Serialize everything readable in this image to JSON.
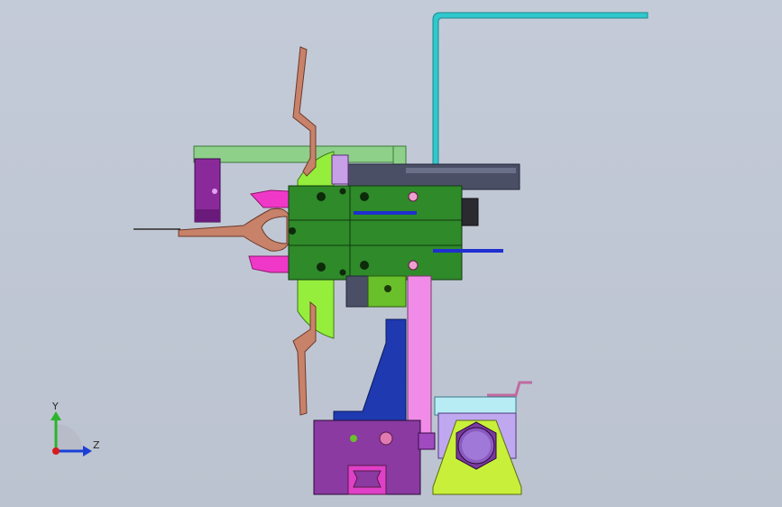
{
  "viewport": {
    "background_top": "#c4cbd8",
    "background_bottom": "#bcc3d0"
  },
  "triad": {
    "y_label": "Y",
    "z_label": "Z",
    "y_color": "#2bb52b",
    "z_color": "#1c3fd6",
    "x_color": "#d61c1c"
  },
  "colors": {
    "cyan_tube": "#30c8cc",
    "light_green_bar": "#8ed08a",
    "gripper_body": "#2f8a2a",
    "lime_plate": "#95ee3c",
    "copper_part": "#c8826a",
    "magenta_finger": "#f038c8",
    "purple_bracket": "#8a2a9a",
    "dark_rail": "#4a4f66",
    "blue_rod": "#1f2fd0",
    "pink_column": "#f08ce8",
    "navy_gusset": "#1f3ab0",
    "purple_block": "#8a3aa0",
    "yellow_green_base": "#c8f03a",
    "light_cyan_block": "#b8ecf4",
    "lavender_block": "#c0a8f0",
    "wire": "#2a2a2a"
  }
}
